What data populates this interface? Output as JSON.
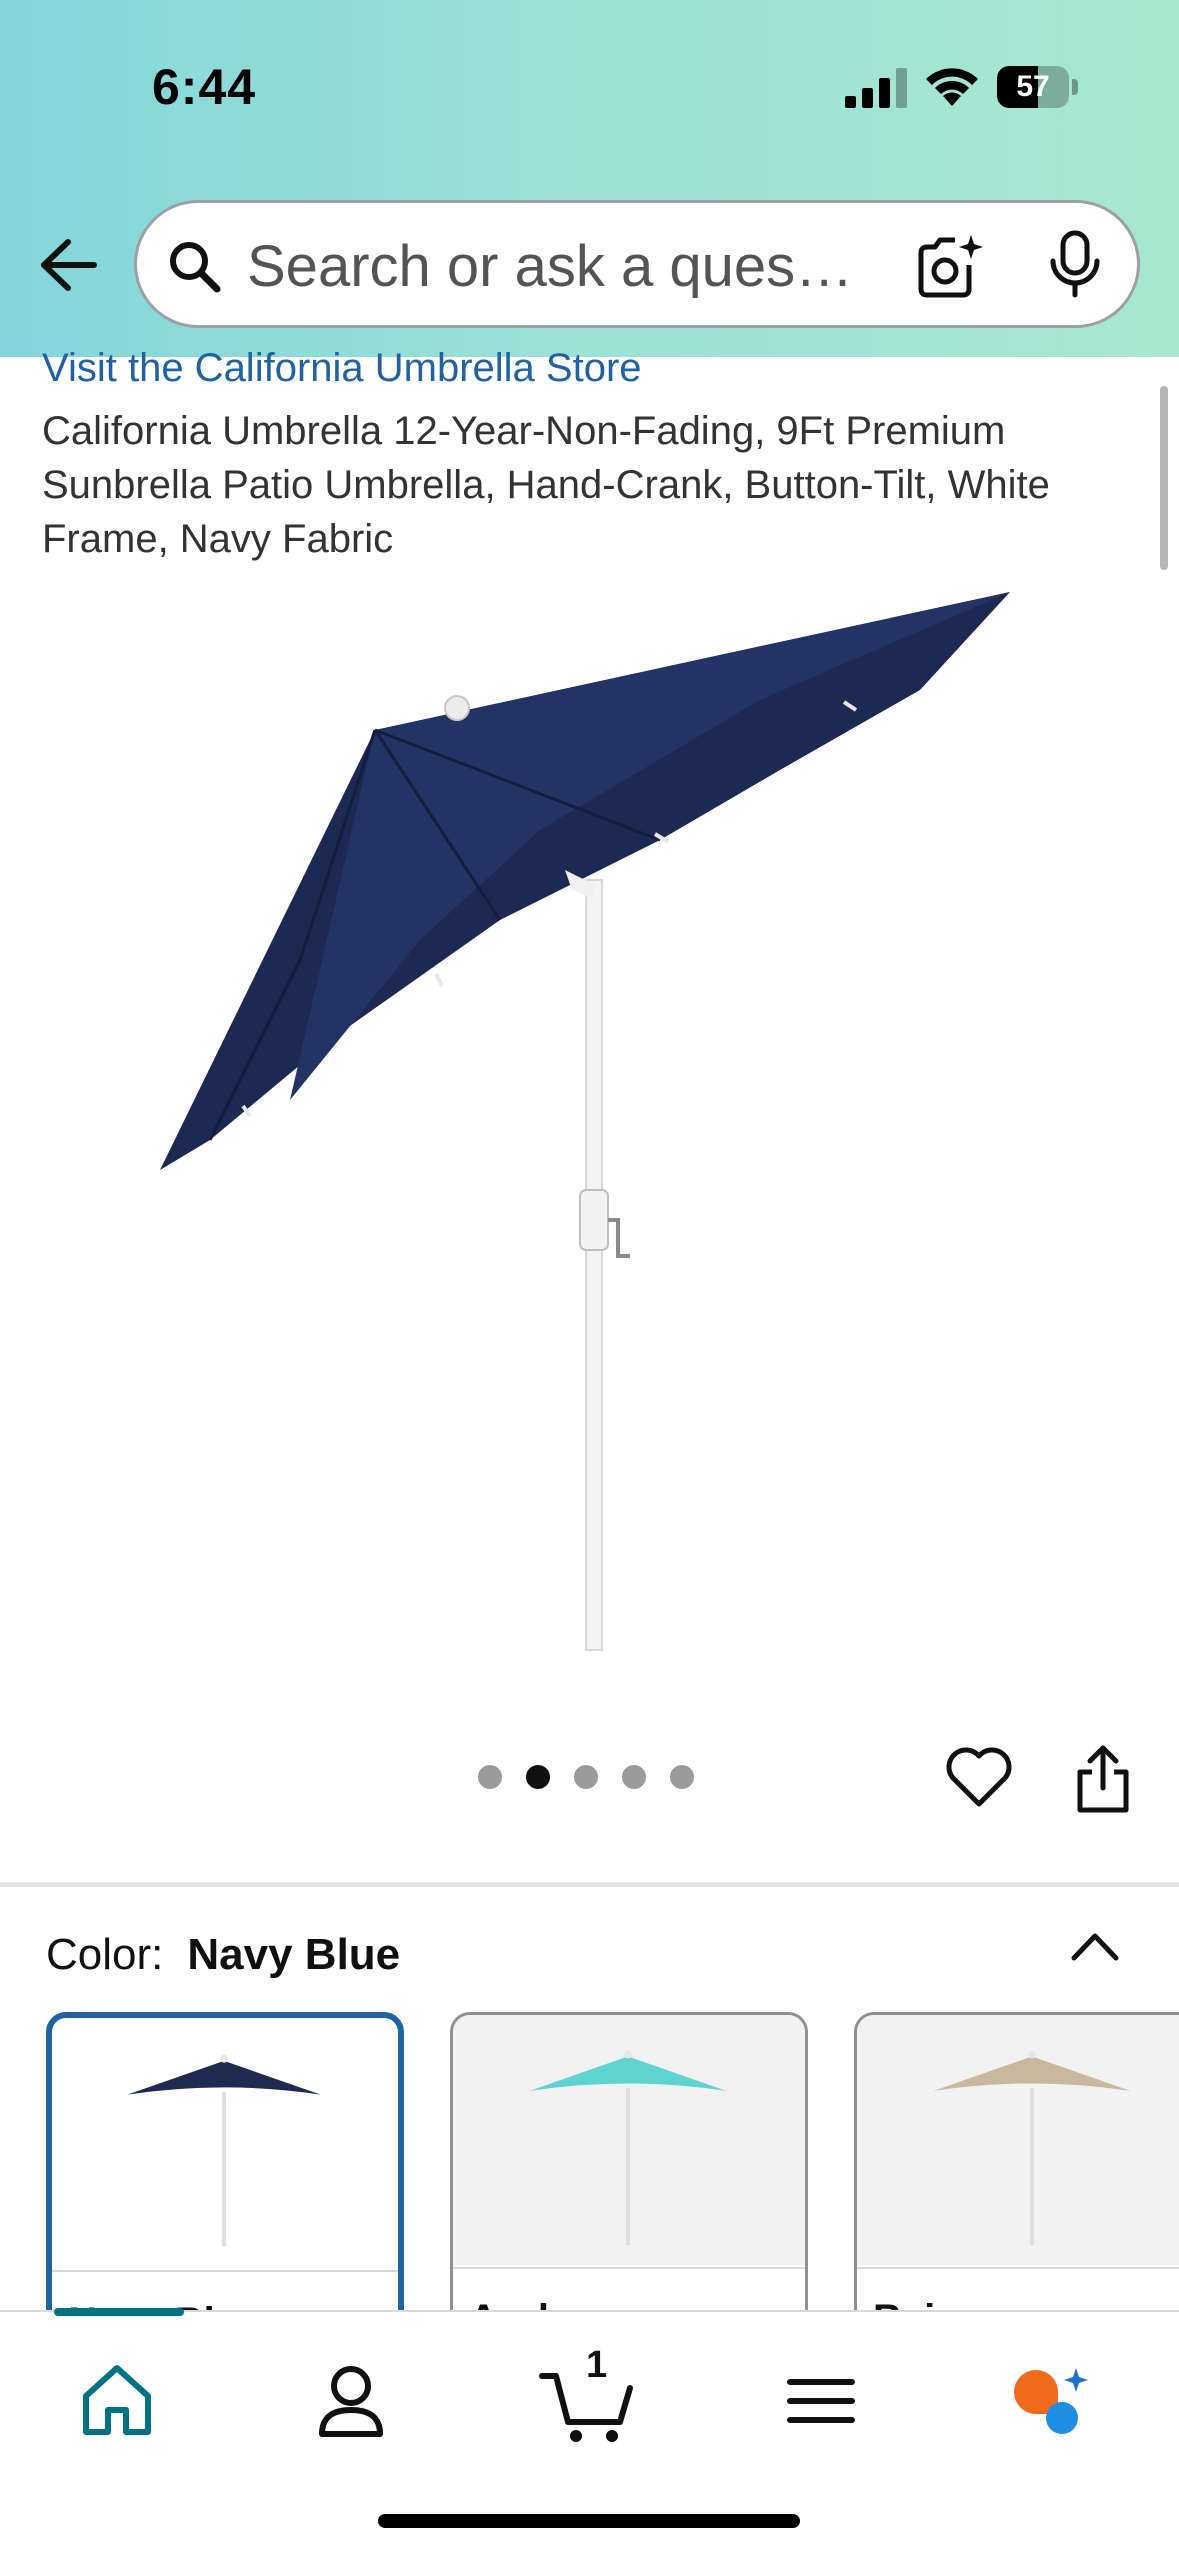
{
  "status_bar": {
    "time": "6:44",
    "battery": "57",
    "battery_level": 0.57
  },
  "search": {
    "placeholder": "Search or ask a question"
  },
  "product": {
    "store_link": "Visit the California Umbrella Store",
    "title": "California Umbrella 12-Year-Non-Fading, 9Ft Premium Sunbrella Patio Umbrella, Hand-Crank, Button-Tilt, White Frame, Navy Fabric"
  },
  "carousel": {
    "count": 5,
    "active_index": 1
  },
  "color_selector": {
    "label": "Color:",
    "selected": "Navy Blue",
    "swatches": [
      {
        "name": "Navy Blue",
        "color": "#1e2a4f"
      },
      {
        "name": "Aruba",
        "color": "#5fd3cf"
      },
      {
        "name": "Beige",
        "color": "#c9b8a0"
      }
    ]
  },
  "tab_bar": {
    "cart_count": "1",
    "tabs": [
      "home-icon",
      "account-icon",
      "cart-icon",
      "menu-icon",
      "rufus-icon"
    ],
    "accent": "#007185"
  }
}
